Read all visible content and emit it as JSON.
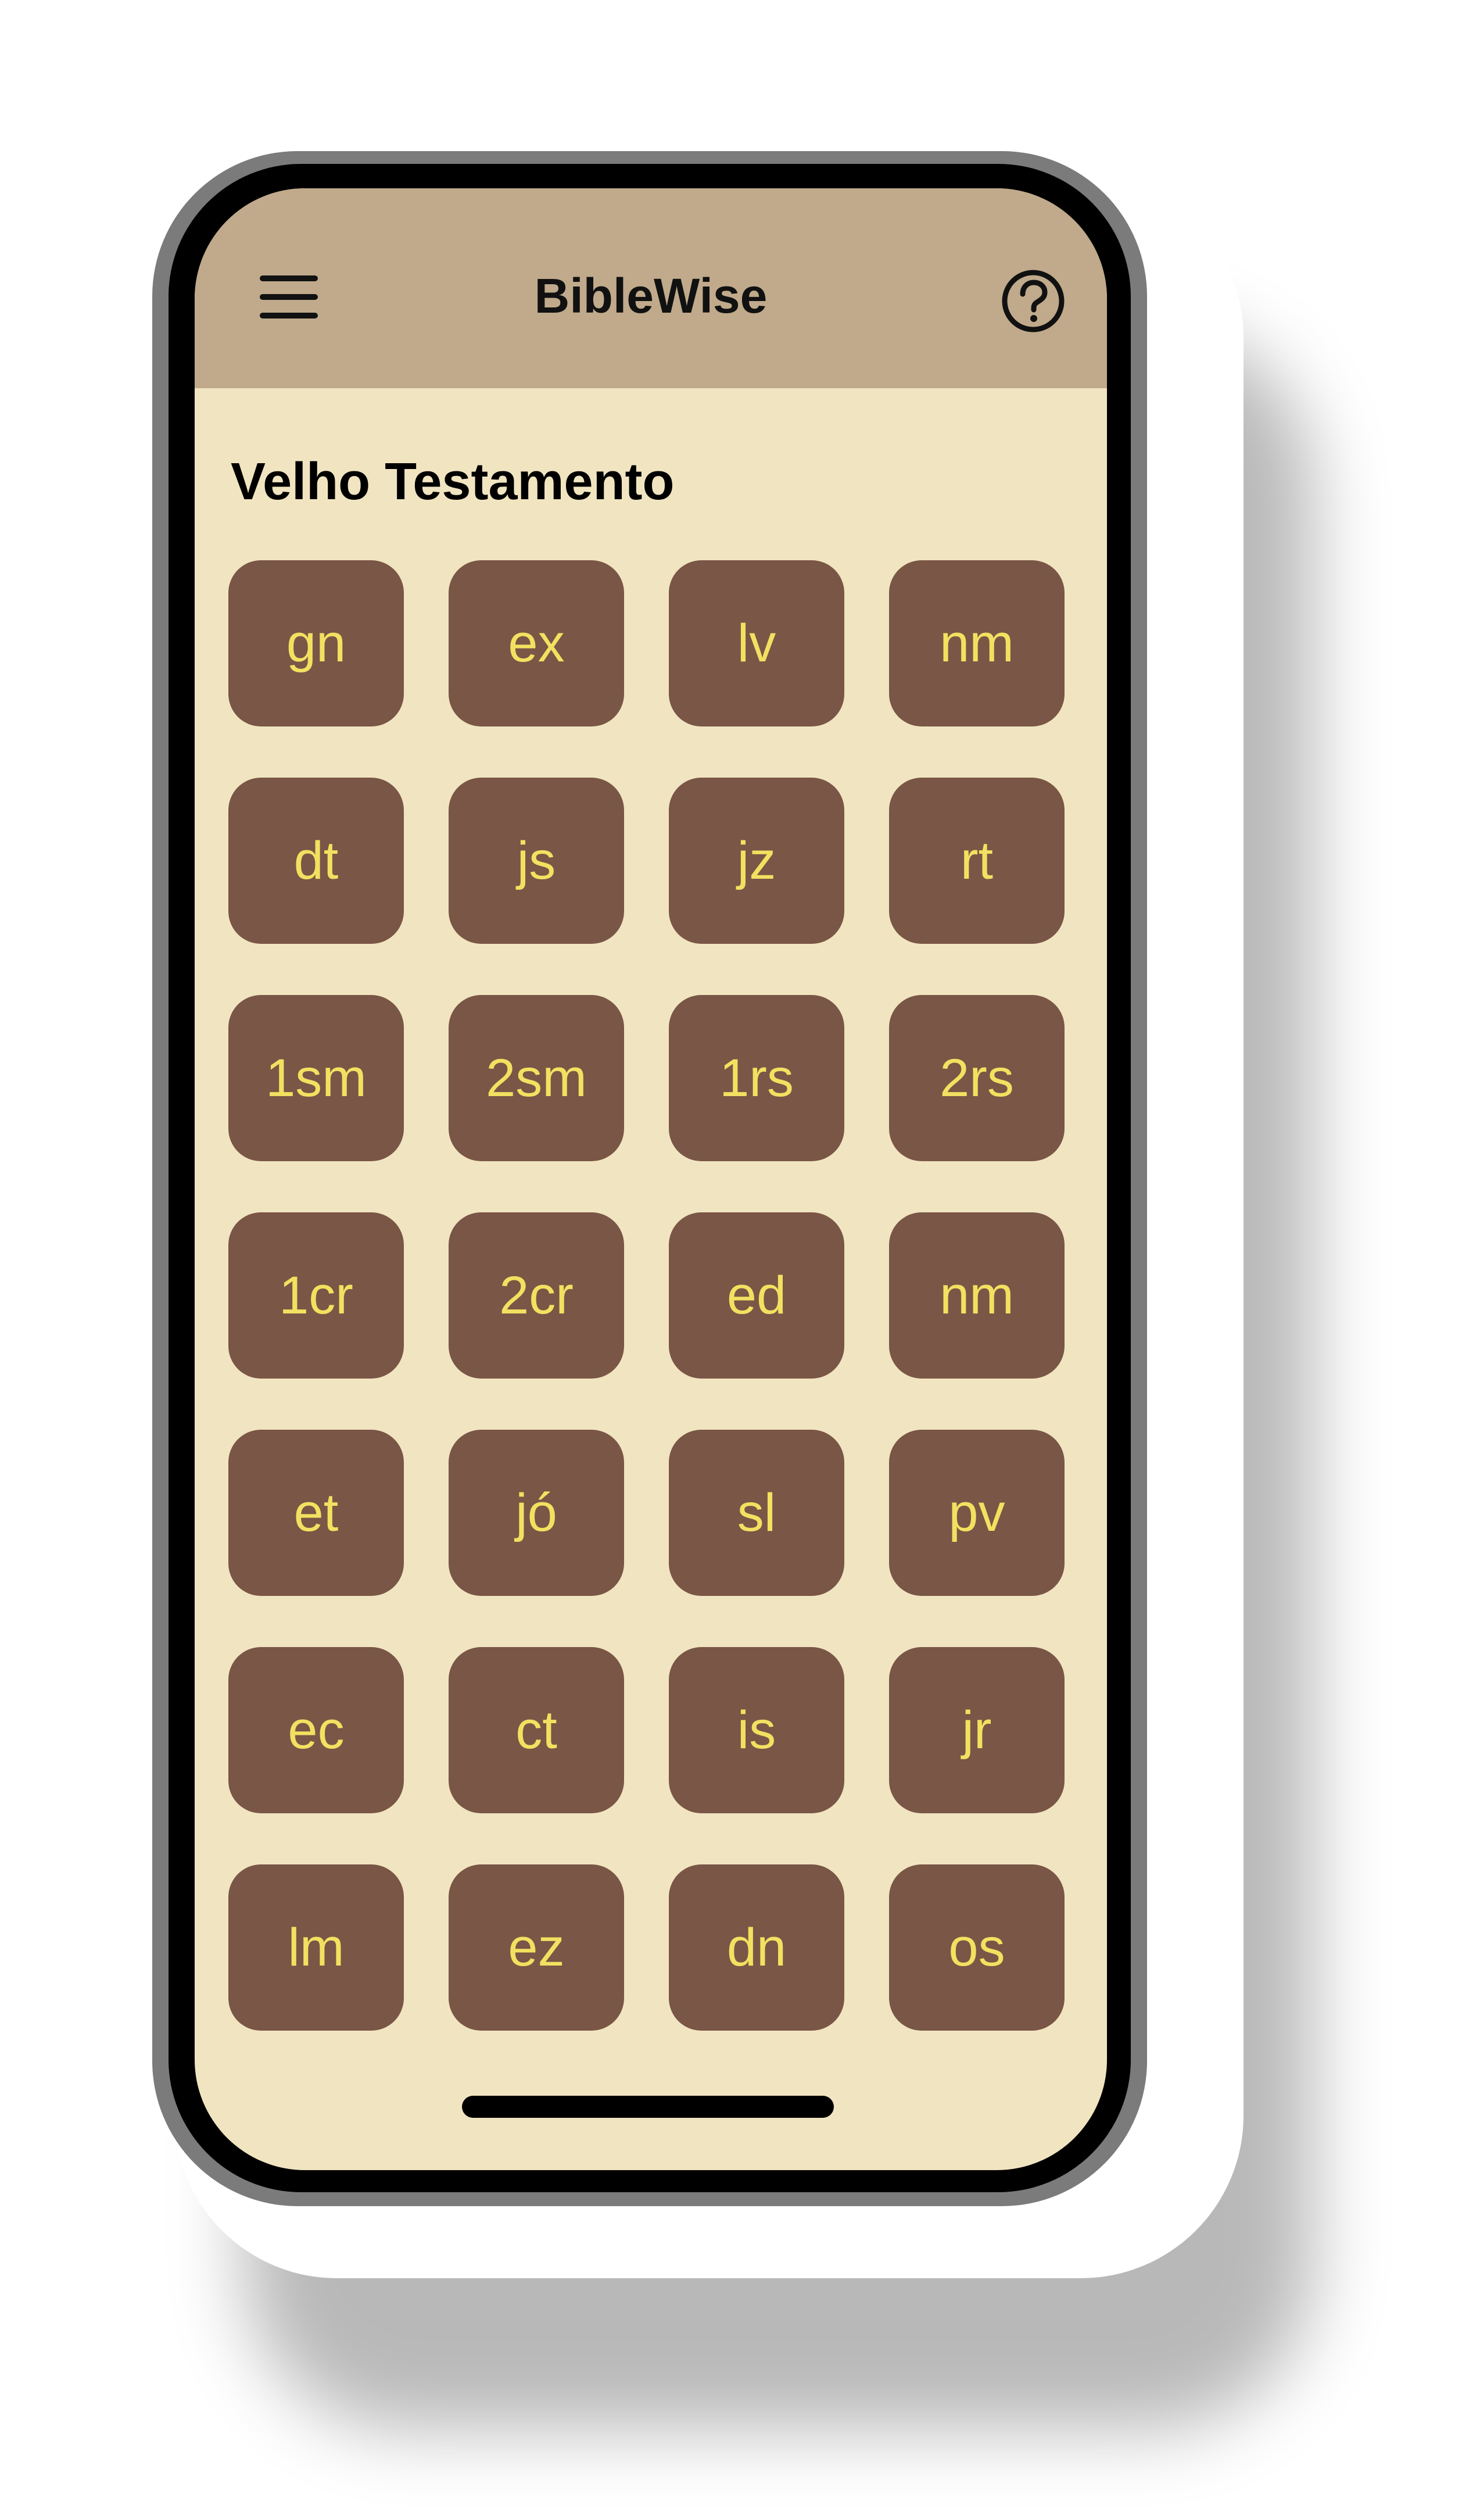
{
  "app": {
    "title": "BibleWise"
  },
  "header": {
    "menu_icon": "hamburger-menu-icon",
    "help_icon": "question-circle-icon",
    "background_color": "#c0aa8b"
  },
  "section": {
    "title": "Velho Testamento"
  },
  "books": [
    "gn",
    "ex",
    "lv",
    "nm",
    "dt",
    "js",
    "jz",
    "rt",
    "1sm",
    "2sm",
    "1rs",
    "2rs",
    "1cr",
    "2cr",
    "ed",
    "nm",
    "et",
    "jó",
    "sl",
    "pv",
    "ec",
    "ct",
    "is",
    "jr",
    "lm",
    "ez",
    "dn",
    "os"
  ],
  "colors": {
    "screen_background": "#f1e5c1",
    "button_background": "#7a5646",
    "button_text": "#f2e160"
  }
}
